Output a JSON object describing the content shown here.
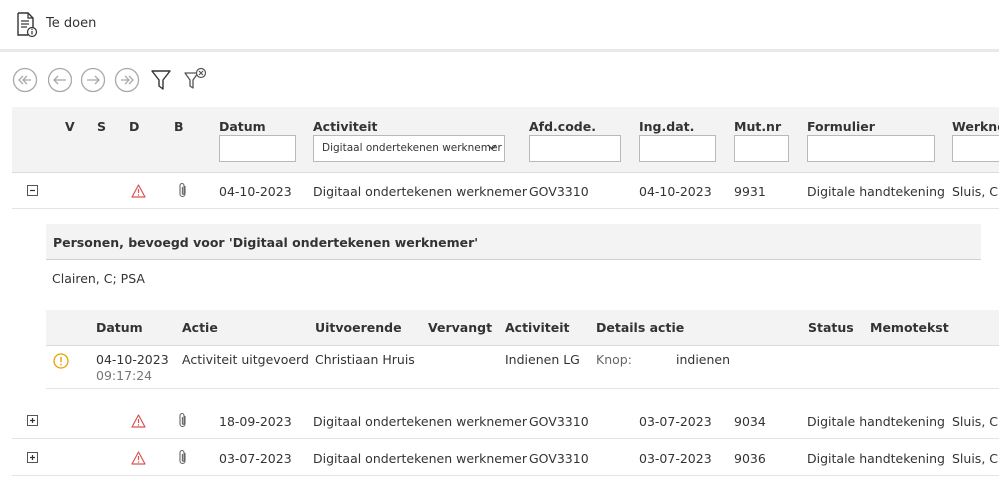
{
  "header": {
    "title": "Te doen",
    "icon": "document-info-icon"
  },
  "toolbar": {
    "buttons": [
      {
        "name": "first-page",
        "icon": "first-page-icon"
      },
      {
        "name": "previous-page",
        "icon": "previous-page-icon"
      },
      {
        "name": "next-page",
        "icon": "next-page-icon"
      },
      {
        "name": "last-page",
        "icon": "last-page-icon"
      },
      {
        "name": "filter",
        "icon": "filter-icon"
      },
      {
        "name": "clear-filter",
        "icon": "filter-clear-icon"
      }
    ]
  },
  "grid": {
    "columns": {
      "v": "V",
      "s": "S",
      "d": "D",
      "b": "B",
      "datum": "Datum",
      "activiteit": "Activiteit",
      "afdcode": "Afd.code.",
      "ingdat": "Ing.dat.",
      "mutnr": "Mut.nr",
      "formulier": "Formulier",
      "werknemer": "Werknemer"
    },
    "filters": {
      "activiteit_selected": "Digitaal ondertekenen werknemer"
    },
    "rows": [
      {
        "datum": "04-10-2023",
        "activiteit": "Digitaal ondertekenen werknemer",
        "afdcode": "GOV3310",
        "ingdat": "04-10-2023",
        "mutnr": "9931",
        "formulier": "Digitale handtekening",
        "werknemer": "Sluis, C",
        "expanded": true
      },
      {
        "datum": "18-09-2023",
        "activiteit": "Digitaal ondertekenen werknemer",
        "afdcode": "GOV3310",
        "ingdat": "03-07-2023",
        "mutnr": "9034",
        "formulier": "Digitale handtekening",
        "werknemer": "Sluis, C",
        "expanded": false
      },
      {
        "datum": "03-07-2023",
        "activiteit": "Digitaal ondertekenen werknemer",
        "afdcode": "GOV3310",
        "ingdat": "03-07-2023",
        "mutnr": "9036",
        "formulier": "Digitale handtekening",
        "werknemer": "Sluis, C",
        "expanded": false
      }
    ]
  },
  "detail": {
    "title": "Personen, bevoegd voor 'Digitaal ondertekenen werknemer'",
    "persons": "Clairen, C; PSA",
    "columns": {
      "datum": "Datum",
      "actie": "Actie",
      "uitvoerende": "Uitvoerende",
      "vervangt": "Vervangt",
      "activiteit": "Activiteit",
      "details": "Details actie",
      "status": "Status",
      "memotekst": "Memotekst"
    },
    "rows": [
      {
        "datum": "04-10-2023",
        "tijd": "09:17:24",
        "actie": "Activiteit uitgevoerd",
        "uitvoerende": "Christiaan Hruis",
        "vervangt": "",
        "activiteit": "Indienen LG",
        "details_label": "Knop:",
        "details_value": "indienen",
        "status": "",
        "memotekst": ""
      }
    ]
  },
  "colors": {
    "warning": "#d9534f",
    "info": "#e8a000",
    "toolbar_icon": "#a9a9a9",
    "header_bg": "#f3f3f3"
  }
}
